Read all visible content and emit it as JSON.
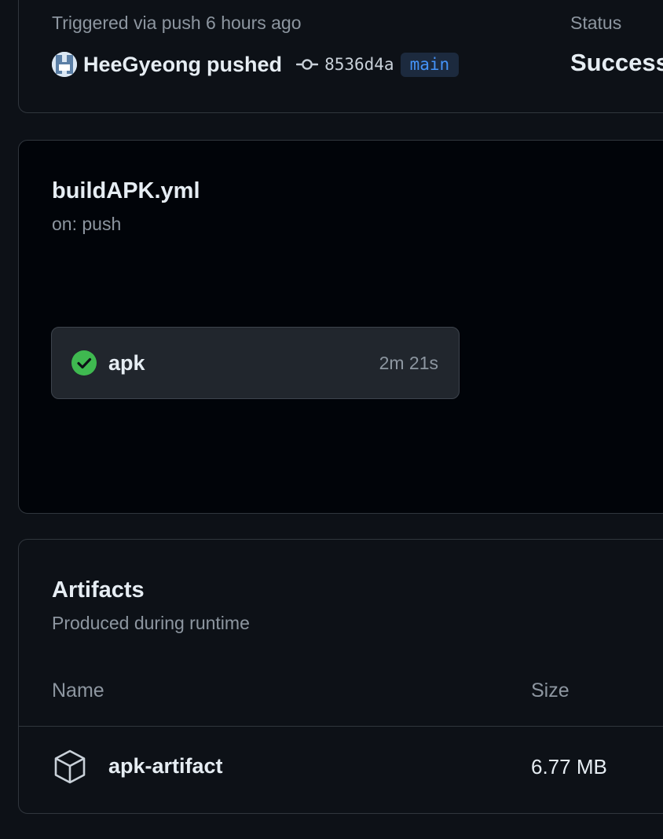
{
  "summary": {
    "trigger_text": "Triggered via push 6 hours ago",
    "pusher": "HeeGyeong",
    "action": "pushed",
    "commit_sha": "8536d4a",
    "branch": "main",
    "status_label": "Status",
    "status_value": "Success"
  },
  "workflow": {
    "file": "buildAPK.yml",
    "event": "on: push",
    "job": {
      "name": "apk",
      "duration": "2m 21s",
      "status_icon": "check-circle-fill-icon"
    }
  },
  "artifacts": {
    "title": "Artifacts",
    "subtitle": "Produced during runtime",
    "columns": [
      "Name",
      "Size"
    ],
    "rows": [
      {
        "icon": "package-icon",
        "name": "apk-artifact",
        "size": "6.77 MB"
      }
    ]
  },
  "colors": {
    "success": "#3fb950",
    "link": "#4493f8",
    "muted": "#8d96a0",
    "border": "#30363d"
  }
}
